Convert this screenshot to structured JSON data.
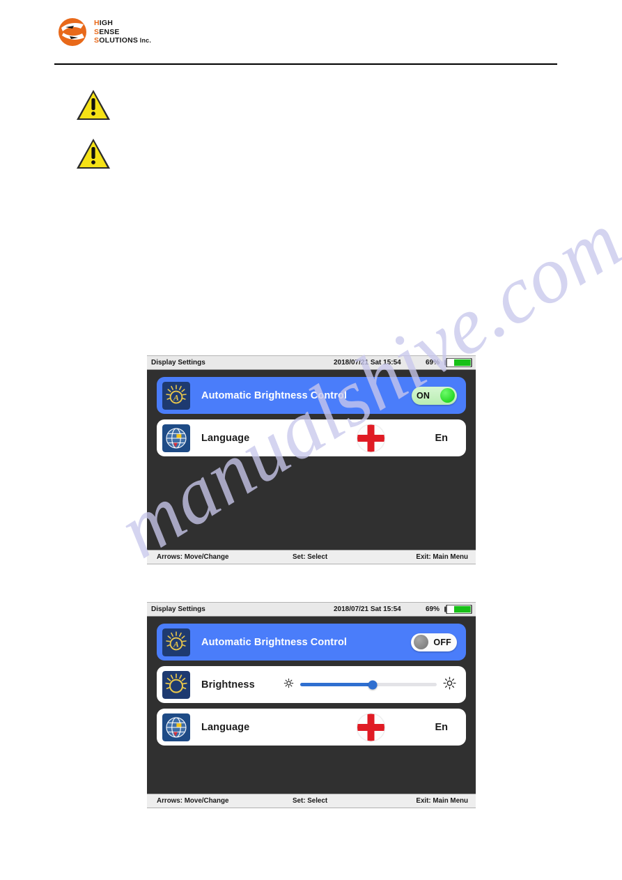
{
  "document": {
    "watermark": "manualshive.com",
    "logo": {
      "line1_accent": "H",
      "line1_rest": "IGH",
      "line2_accent": "S",
      "line2_rest": "ENSE",
      "line3_accent": "S",
      "line3_rest": "OLUTIONS",
      "suffix": "Inc.",
      "mark_color": "#e8691a",
      "accent_color": "#e8691a"
    },
    "warnings": [
      {
        "name": "warning-triangle-1",
        "glyph": "!"
      },
      {
        "name": "warning-triangle-2",
        "glyph": "!"
      }
    ]
  },
  "screens": [
    {
      "id": "display-settings-auto-on",
      "status_bar": {
        "title": "Display Settings",
        "datetime": "2018/07/21 Sat 15:54",
        "battery_percent": "69%",
        "battery_level": 69,
        "battery_color": "#18c018"
      },
      "rows": [
        {
          "type": "toggle",
          "icon": "auto-brightness-icon",
          "label": "Automatic Brightness Control",
          "selected": true,
          "toggle_state": "ON"
        },
        {
          "type": "language",
          "icon": "globe-icon",
          "label": "Language",
          "selected": false,
          "flag": "england-flag",
          "language_code": "En"
        }
      ],
      "footer": {
        "left": "Arrows: Move/Change",
        "center": "Set: Select",
        "right": "Exit: Main Menu"
      }
    },
    {
      "id": "display-settings-auto-off",
      "status_bar": {
        "title": "Display Settings",
        "datetime": "2018/07/21 Sat 15:54",
        "battery_percent": "69%",
        "battery_level": 69,
        "battery_color": "#18c018"
      },
      "rows": [
        {
          "type": "toggle",
          "icon": "auto-brightness-icon",
          "label": "Automatic Brightness Control",
          "selected": true,
          "toggle_state": "OFF"
        },
        {
          "type": "slider",
          "icon": "brightness-icon",
          "label": "Brightness",
          "selected": false,
          "slider_value": 53,
          "slider_min_icon": "small-sun-icon",
          "slider_max_icon": "large-sun-icon",
          "slider_color": "#2f6fd0"
        },
        {
          "type": "language",
          "icon": "globe-icon",
          "label": "Language",
          "selected": false,
          "flag": "england-flag",
          "language_code": "En"
        }
      ],
      "footer": {
        "left": "Arrows: Move/Change",
        "center": "Set: Select",
        "right": "Exit: Main Menu"
      }
    }
  ]
}
